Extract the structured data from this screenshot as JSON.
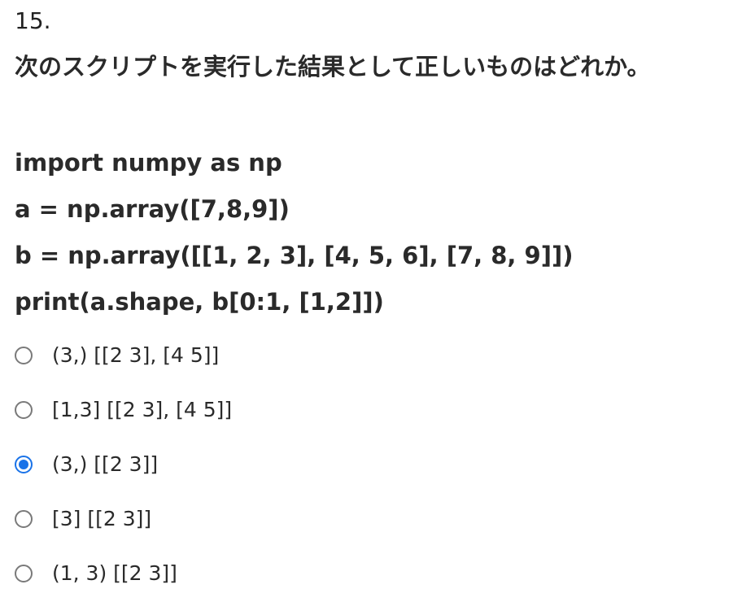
{
  "question": {
    "number": "15.",
    "text": "次のスクリプトを実行した結果として正しいものはどれか。",
    "code_lines": [
      "import numpy as np",
      "a = np.array([7,8,9])",
      "b = np.array([[1, 2, 3], [4, 5, 6], [7, 8, 9]])",
      "print(a.shape, b[0:1, [1,2]])"
    ]
  },
  "options": [
    {
      "label": "(3,) [[2 3], [4 5]]",
      "selected": false
    },
    {
      "label": "[1,3] [[2 3], [4 5]]",
      "selected": false
    },
    {
      "label": "(3,) [[2 3]]",
      "selected": true
    },
    {
      "label": "[3] [[2 3]]",
      "selected": false
    },
    {
      "label": "(1, 3) [[2 3]]",
      "selected": false
    }
  ],
  "colors": {
    "accent": "#1a73e8",
    "radio_border": "#7a7a7a",
    "text": "#2a2a2a"
  }
}
